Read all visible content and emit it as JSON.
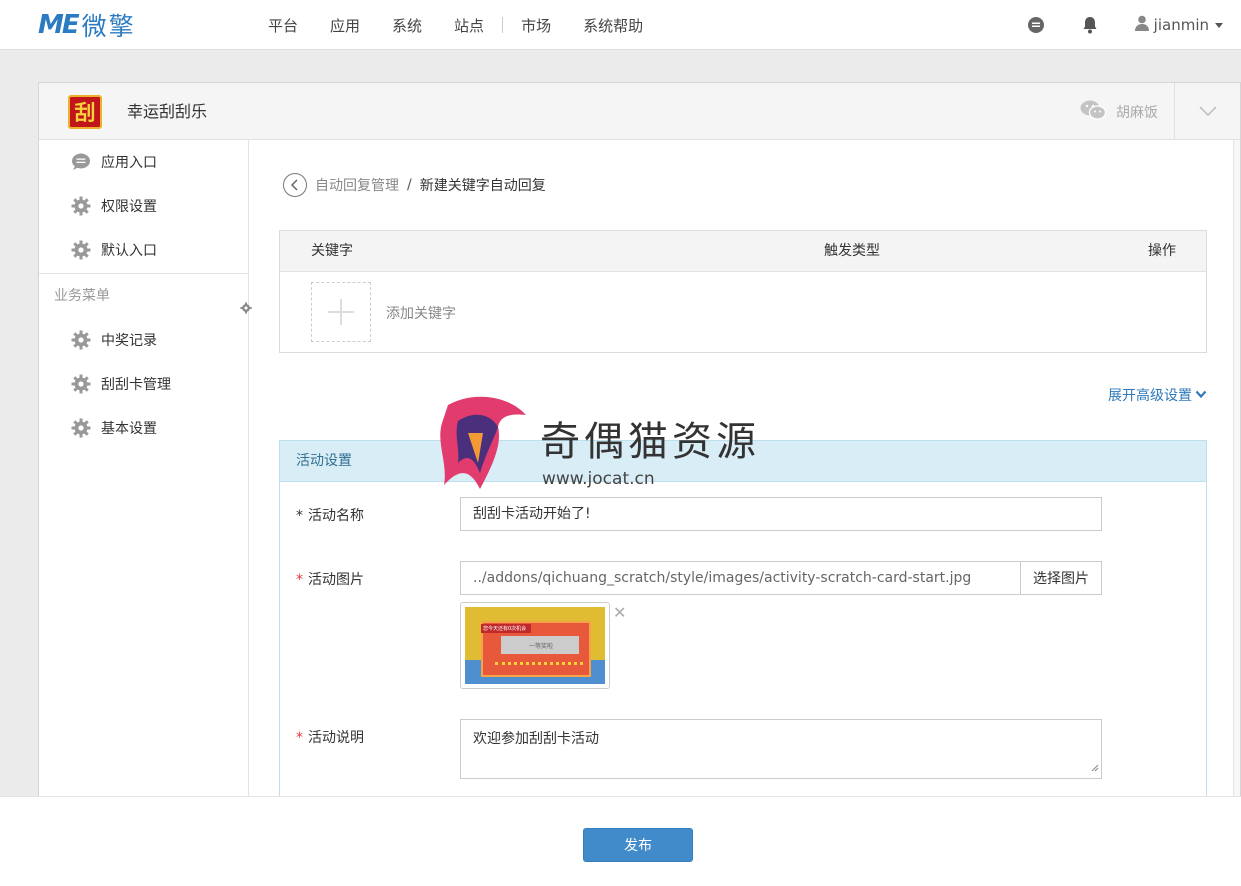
{
  "logo": {
    "mark": "ME",
    "text": "微擎"
  },
  "nav": {
    "items": [
      "平台",
      "应用",
      "系统",
      "站点",
      "市场",
      "系统帮助"
    ]
  },
  "user": {
    "name": "jianmin"
  },
  "app": {
    "icon_char": "刮",
    "title": "幸运刮刮乐",
    "account": "胡麻饭"
  },
  "sidebar": {
    "top_items": [
      {
        "label": "应用入口",
        "icon": "chat-bubble-icon"
      },
      {
        "label": "权限设置",
        "icon": "gear-icon"
      },
      {
        "label": "默认入口",
        "icon": "gear-icon"
      }
    ],
    "group_label": "业务菜单",
    "biz_items": [
      {
        "label": "中奖记录",
        "icon": "gear-icon"
      },
      {
        "label": "刮刮卡管理",
        "icon": "gear-icon"
      },
      {
        "label": "基本设置",
        "icon": "gear-icon"
      }
    ]
  },
  "breadcrumb": {
    "parent": "自动回复管理",
    "separator": "/",
    "current": "新建关键字自动回复"
  },
  "keyword_table": {
    "headers": [
      "关键字",
      "触发类型",
      "操作"
    ],
    "add_label": "添加关键字"
  },
  "advanced_link": "展开高级设置",
  "activity": {
    "section_title": "活动设置",
    "name_label": "活动名称",
    "name_value": "刮刮卡活动开始了!",
    "image_label": "活动图片",
    "image_path": "../addons/qichuang_scratch/style/images/activity-scratch-card-start.jpg",
    "choose_image": "选择图片",
    "thumb_banner": "您今天还有0次机会",
    "thumb_button": "一等奖啦",
    "desc_label": "活动说明",
    "desc_value": "欢迎参加刮刮卡活动",
    "required_mark": "*"
  },
  "watermark": {
    "title": "奇偶猫资源",
    "url": "www.jocat.cn"
  },
  "publish_label": "发布",
  "colors": {
    "brand": "#2b7bc2",
    "primary_button": "#428bca",
    "required": "#e4393c",
    "section_header": "#d9edf7"
  }
}
